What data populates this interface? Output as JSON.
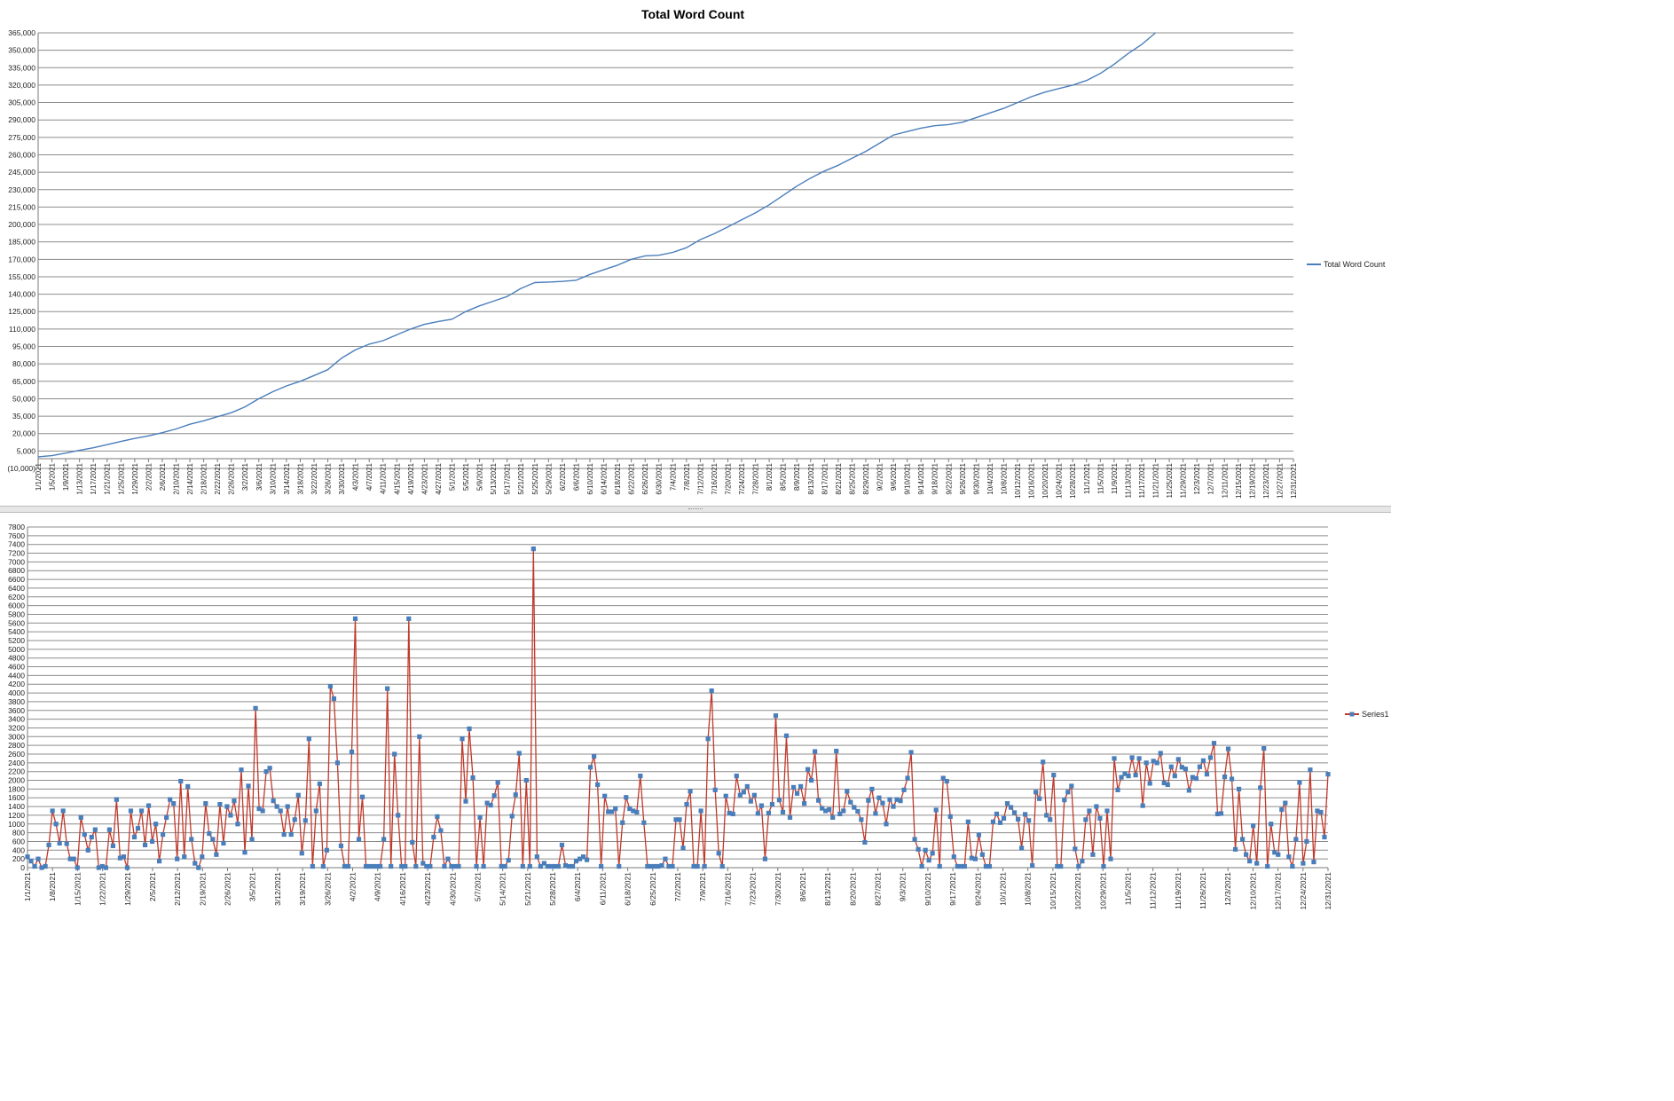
{
  "chart_data": [
    {
      "type": "line",
      "title": "Total Word Count",
      "xlabel": "",
      "ylabel": "",
      "ylim": [
        -10000,
        365000
      ],
      "y_step": 15000,
      "x_range": [
        "1/1/2021",
        "12/31/2021"
      ],
      "x_tick_every_days": 4,
      "grid": true,
      "legend_position": "right",
      "series": [
        {
          "name": "Total Word Count",
          "color": "#4a7ebb",
          "points": [
            [
              "1/1/2021",
              0
            ],
            [
              "1/5/2021",
              1000
            ],
            [
              "1/9/2021",
              3200
            ],
            [
              "1/13/2021",
              5600
            ],
            [
              "1/17/2021",
              7800
            ],
            [
              "1/21/2021",
              10500
            ],
            [
              "1/25/2021",
              13200
            ],
            [
              "1/29/2021",
              15800
            ],
            [
              "2/2/2021",
              18000
            ],
            [
              "2/6/2021",
              20800
            ],
            [
              "2/10/2021",
              24000
            ],
            [
              "2/14/2021",
              28000
            ],
            [
              "2/18/2021",
              31000
            ],
            [
              "2/22/2021",
              34500
            ],
            [
              "2/26/2021",
              38000
            ],
            [
              "3/2/2021",
              43000
            ],
            [
              "3/6/2021",
              50000
            ],
            [
              "3/10/2021",
              56000
            ],
            [
              "3/14/2021",
              61000
            ],
            [
              "3/18/2021",
              65000
            ],
            [
              "3/22/2021",
              70000
            ],
            [
              "3/26/2021",
              75000
            ],
            [
              "3/30/2021",
              85000
            ],
            [
              "4/3/2021",
              92000
            ],
            [
              "4/7/2021",
              97000
            ],
            [
              "4/11/2021",
              100000
            ],
            [
              "4/15/2021",
              105000
            ],
            [
              "4/19/2021",
              110000
            ],
            [
              "4/23/2021",
              114000
            ],
            [
              "4/27/2021",
              116500
            ],
            [
              "5/1/2021",
              118500
            ],
            [
              "5/5/2021",
              125000
            ],
            [
              "5/9/2021",
              130000
            ],
            [
              "5/13/2021",
              134000
            ],
            [
              "5/17/2021",
              138000
            ],
            [
              "5/21/2021",
              145000
            ],
            [
              "5/25/2021",
              150000
            ],
            [
              "5/29/2021",
              150500
            ],
            [
              "6/2/2021",
              151000
            ],
            [
              "6/6/2021",
              152000
            ],
            [
              "6/10/2021",
              157000
            ],
            [
              "6/14/2021",
              161000
            ],
            [
              "6/18/2021",
              165000
            ],
            [
              "6/22/2021",
              170000
            ],
            [
              "6/26/2021",
              173000
            ],
            [
              "6/30/2021",
              173500
            ],
            [
              "7/4/2021",
              176000
            ],
            [
              "7/8/2021",
              180000
            ],
            [
              "7/12/2021",
              187000
            ],
            [
              "7/16/2021",
              192000
            ],
            [
              "7/20/2021",
              198000
            ],
            [
              "7/24/2021",
              204000
            ],
            [
              "7/28/2021",
              210000
            ],
            [
              "8/1/2021",
              217000
            ],
            [
              "8/5/2021",
              225000
            ],
            [
              "8/9/2021",
              233000
            ],
            [
              "8/13/2021",
              240000
            ],
            [
              "8/17/2021",
              246000
            ],
            [
              "8/21/2021",
              251000
            ],
            [
              "8/25/2021",
              257000
            ],
            [
              "8/29/2021",
              263000
            ],
            [
              "9/2/2021",
              270000
            ],
            [
              "9/6/2021",
              277000
            ],
            [
              "9/10/2021",
              280000
            ],
            [
              "9/14/2021",
              283000
            ],
            [
              "9/18/2021",
              285000
            ],
            [
              "9/22/2021",
              286000
            ],
            [
              "9/26/2021",
              288000
            ],
            [
              "9/30/2021",
              292000
            ],
            [
              "10/4/2021",
              296000
            ],
            [
              "10/8/2021",
              300000
            ],
            [
              "10/12/2021",
              305000
            ],
            [
              "10/16/2021",
              310000
            ],
            [
              "10/20/2021",
              314000
            ],
            [
              "10/24/2021",
              317000
            ],
            [
              "10/28/2021",
              320000
            ],
            [
              "11/1/2021",
              324000
            ],
            [
              "11/5/2021",
              330000
            ],
            [
              "11/9/2021",
              338000
            ],
            [
              "11/13/2021",
              347000
            ],
            [
              "11/17/2021",
              355000
            ],
            [
              "11/21/2021",
              365000
            ]
          ]
        }
      ]
    },
    {
      "type": "line",
      "title": "",
      "xlabel": "",
      "ylabel": "",
      "ylim": [
        0,
        7800
      ],
      "y_step": 200,
      "x_range": [
        "1/1/2021",
        "12/31/2021"
      ],
      "x_tick_every_days": 7,
      "grid": true,
      "legend_position": "right",
      "markers": "square",
      "series": [
        {
          "name": "Series1",
          "color": "#c0392b",
          "marker_color": "#4a7ebb",
          "values": [
            250,
            150,
            30,
            200,
            0,
            30,
            520,
            1300,
            1000,
            560,
            1300,
            550,
            200,
            200,
            0,
            1150,
            760,
            400,
            700,
            870,
            0,
            30,
            0,
            870,
            500,
            1560,
            220,
            250,
            0,
            1300,
            700,
            900,
            1300,
            520,
            1420,
            600,
            1000,
            150,
            760,
            1150,
            1560,
            1470,
            200,
            1980,
            250,
            1860,
            650,
            100,
            0,
            250,
            1470,
            780,
            650,
            300,
            1450,
            560,
            1400,
            1200,
            1530,
            1000,
            2240,
            350,
            1870,
            650,
            3650,
            1350,
            1300,
            2200,
            2280,
            1530,
            1400,
            1300,
            760,
            1400,
            760,
            1100,
            1660,
            330,
            1080,
            2950,
            30,
            1300,
            1920,
            30,
            400,
            4150,
            3870,
            2400,
            500,
            30,
            30,
            2650,
            5700,
            650,
            1620,
            30,
            30,
            30,
            30,
            30,
            650,
            4100,
            30,
            2600,
            1200,
            30,
            30,
            5700,
            580,
            30,
            3000,
            100,
            30,
            30,
            700,
            1170,
            850,
            30,
            200,
            30,
            30,
            30,
            2950,
            1520,
            3180,
            2060,
            30,
            1150,
            30,
            1480,
            1430,
            1650,
            1950,
            30,
            30,
            170,
            1180,
            1670,
            2620,
            30,
            2000,
            30,
            7300,
            250,
            30,
            100,
            30,
            30,
            30,
            30,
            520,
            50,
            30,
            30,
            150,
            200,
            250,
            180,
            2300,
            2550,
            1900,
            30,
            1640,
            1280,
            1280,
            1350,
            30,
            1030,
            1610,
            1350,
            1300,
            1270,
            2100,
            1030,
            30,
            30,
            30,
            30,
            50,
            200,
            30,
            30,
            1100,
            1100,
            450,
            1450,
            1750,
            30,
            30,
            1300,
            30,
            2950,
            4050,
            1780,
            330,
            30,
            1640,
            1250,
            1230,
            2100,
            1660,
            1730,
            1860,
            1520,
            1660,
            1240,
            1420,
            200,
            1250,
            1450,
            3480,
            1550,
            1270,
            3020,
            1150,
            1840,
            1700,
            1860,
            1470,
            2250,
            2000,
            2660,
            1540,
            1360,
            1300,
            1330,
            1150,
            2670,
            1230,
            1300,
            1750,
            1500,
            1380,
            1290,
            1100,
            580,
            1540,
            1800,
            1240,
            1600,
            1480,
            1000,
            1560,
            1400,
            1560,
            1530,
            1780,
            2050,
            2640,
            650,
            420,
            30,
            400,
            170,
            330,
            1320,
            30,
            2050,
            1980,
            1170,
            250,
            30,
            30,
            30,
            1050,
            220,
            200,
            750,
            300,
            30,
            30,
            1050,
            1230,
            1030,
            1130,
            1470,
            1380,
            1260,
            1110,
            450,
            1220,
            1080,
            50,
            1730,
            1580,
            2420,
            1200,
            1100,
            2120,
            30,
            30,
            1550,
            1730,
            1870,
            430,
            30,
            150,
            1100,
            1300,
            300,
            1400,
            1130,
            30,
            1300,
            200,
            2500,
            1780,
            2070,
            2150,
            2100,
            2520,
            2120,
            2500,
            1420,
            2400,
            1930,
            2440,
            2400,
            2620,
            1940,
            1900,
            2310,
            2100,
            2480,
            2300,
            2260,
            1770,
            2070,
            2040,
            2310,
            2450,
            2140,
            2520,
            2850,
            1230,
            1240,
            2080,
            2720,
            2030,
            420,
            1800,
            650,
            300,
            150,
            960,
            100,
            1830,
            2730,
            30,
            1000,
            350,
            300,
            1330,
            1480,
            250,
            30,
            650,
            1950,
            100,
            600,
            2240,
            130,
            1300,
            1270,
            700,
            2140
          ]
        }
      ]
    }
  ]
}
